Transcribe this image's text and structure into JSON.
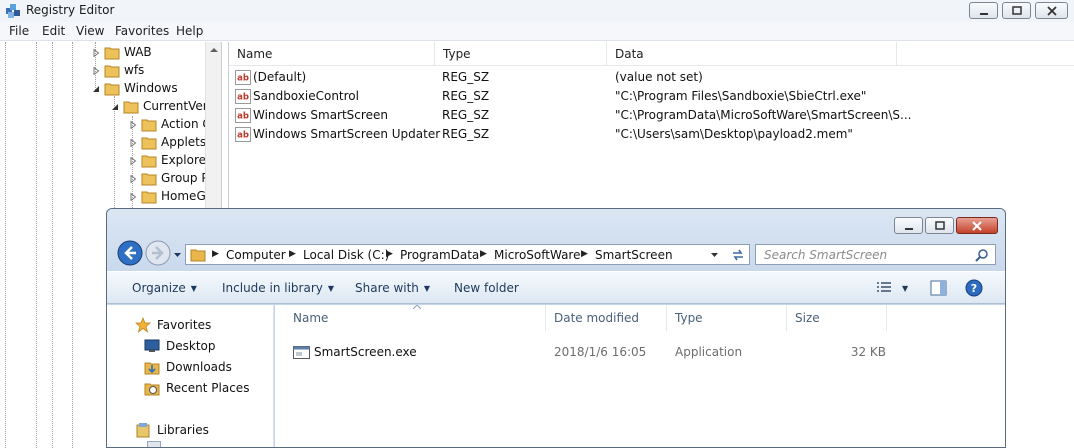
{
  "registry": {
    "title": "Registry Editor",
    "menu": [
      "File",
      "Edit",
      "View",
      "Favorites",
      "Help"
    ],
    "tree": [
      {
        "label": "WAB",
        "expander": "collapsed"
      },
      {
        "label": "wfs",
        "expander": "collapsed"
      },
      {
        "label": "Windows",
        "expander": "expanded"
      },
      {
        "label": "CurrentVers",
        "expander": "expanded"
      },
      {
        "label": "Action C",
        "expander": "collapsed"
      },
      {
        "label": "Applets",
        "expander": "collapsed"
      },
      {
        "label": "Explorer",
        "expander": "collapsed"
      },
      {
        "label": "Group P",
        "expander": "collapsed"
      },
      {
        "label": "HomeGr",
        "expander": "collapsed"
      }
    ],
    "columns": {
      "name": "Name",
      "type": "Type",
      "data": "Data"
    },
    "values": [
      {
        "name": "(Default)",
        "type": "REG_SZ",
        "data": "(value not set)"
      },
      {
        "name": "SandboxieControl",
        "type": "REG_SZ",
        "data": "\"C:\\Program Files\\Sandboxie\\SbieCtrl.exe\""
      },
      {
        "name": "Windows SmartScreen",
        "type": "REG_SZ",
        "data": "\"C:\\ProgramData\\MicroSoftWare\\SmartScreen\\S..."
      },
      {
        "name": "Windows SmartScreen Updater",
        "type": "REG_SZ",
        "data": "\"C:\\Users\\sam\\Desktop\\payload2.mem\""
      }
    ]
  },
  "explorer": {
    "breadcrumb": [
      "Computer",
      "Local Disk (C:)",
      "ProgramData",
      "MicroSoftWare",
      "SmartScreen"
    ],
    "search_placeholder": "Search SmartScreen",
    "commands": {
      "organize": "Organize",
      "include": "Include in library",
      "share": "Share with",
      "new_folder": "New folder"
    },
    "nav": {
      "favorites": "Favorites",
      "items": [
        "Desktop",
        "Downloads",
        "Recent Places"
      ],
      "libraries": "Libraries"
    },
    "columns": {
      "name": "Name",
      "date": "Date modified",
      "type": "Type",
      "size": "Size"
    },
    "files": [
      {
        "name": "SmartScreen.exe",
        "date": "2018/1/6 16:05",
        "type": "Application",
        "size": "32 KB"
      }
    ]
  },
  "colors": {
    "accent": "#1e395b",
    "folder": "#e8b64a",
    "reg_sz_icon": "#c0392b"
  }
}
